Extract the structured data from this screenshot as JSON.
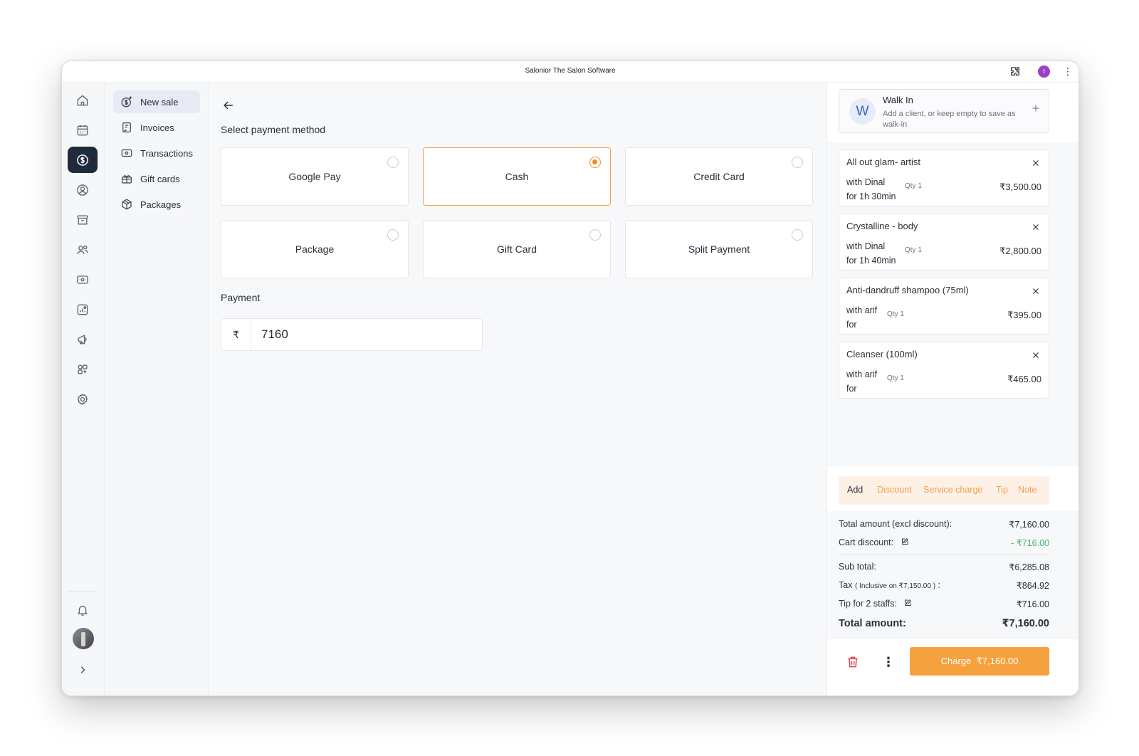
{
  "window": {
    "title": "Salonior The Salon Software",
    "profile_initial": "t"
  },
  "subnav": {
    "items": [
      {
        "label": "New sale"
      },
      {
        "label": "Invoices"
      },
      {
        "label": "Transactions"
      },
      {
        "label": "Gift cards"
      },
      {
        "label": "Packages"
      }
    ]
  },
  "main": {
    "section_title": "Select payment method",
    "payment_methods": [
      {
        "label": "Google Pay",
        "selected": false
      },
      {
        "label": "Cash",
        "selected": true
      },
      {
        "label": "Credit Card",
        "selected": false
      },
      {
        "label": "Package",
        "selected": false
      },
      {
        "label": "Gift Card",
        "selected": false
      },
      {
        "label": "Split Payment",
        "selected": false
      }
    ],
    "payment_label": "Payment",
    "currency_symbol": "₹",
    "payment_value": "7160"
  },
  "client": {
    "avatar": "W",
    "name": "Walk In",
    "hint": "Add a client, or keep empty to save as walk-in"
  },
  "cart": {
    "items": [
      {
        "name": "All out glam- artist",
        "with": "with Dinal",
        "for": "for 1h 30min",
        "qty": "Qty 1",
        "price": "₹3,500.00"
      },
      {
        "name": "Crystalline - body",
        "with": "with Dinal",
        "for": "for 1h 40min",
        "qty": "Qty 1",
        "price": "₹2,800.00"
      },
      {
        "name": "Anti-dandruff shampoo (75ml)",
        "with": "with arif",
        "for": "for",
        "qty": "Qty 1",
        "price": "₹395.00"
      },
      {
        "name": "Cleanser (100ml)",
        "with": "with arif",
        "for": "for",
        "qty": "Qty 1",
        "price": "₹465.00"
      }
    ]
  },
  "actions": {
    "add": "Add",
    "discount": "Discount",
    "service_charge": "Service charge",
    "tip": "Tip",
    "note": "Note"
  },
  "totals": {
    "total_excl_label": "Total amount (excl discount):",
    "total_excl_value": "₹7,160.00",
    "cart_discount_label": "Cart discount:",
    "cart_discount_value": "- ₹716.00",
    "sub_total_label": "Sub total:",
    "sub_total_value": "₹6,285.08",
    "tax_label": "Tax",
    "tax_note": "( Inclusive on ₹7,150.00 )",
    "tax_colon": ":",
    "tax_value": "₹864.92",
    "tip_label": "Tip for 2 staffs:",
    "tip_value": "₹716.00",
    "total_label": "Total amount:",
    "total_value": "₹7,160.00"
  },
  "footer": {
    "charge_label": "Charge",
    "charge_amount": "₹7,160.00"
  },
  "colors": {
    "accent": "#f5a23e",
    "rail_active": "#1f2a3c",
    "discount_green": "#46b467",
    "danger": "#e0414b"
  }
}
